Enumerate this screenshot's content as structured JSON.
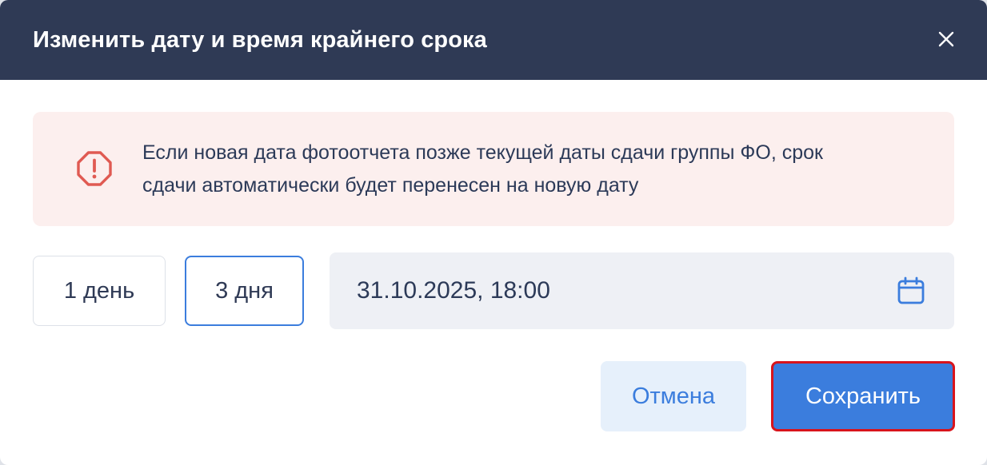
{
  "dialog": {
    "title": "Изменить дату и время крайнего срока",
    "close_icon": "close-icon"
  },
  "alert": {
    "icon": "warning-octagon-icon",
    "line1": "Если новая дата фотоотчета позже текущей даты сдачи группы ФО, срок",
    "line2": "сдачи автоматически будет перенесен на новую дату"
  },
  "quick_options": [
    {
      "label": "1 день",
      "selected": false
    },
    {
      "label": "3 дня",
      "selected": true
    }
  ],
  "datetime": {
    "value": "31.10.2025, 18:00",
    "icon": "calendar-icon"
  },
  "actions": {
    "cancel_label": "Отмена",
    "save_label": "Сохранить"
  },
  "colors": {
    "header_bg": "#2f3a55",
    "accent": "#3b7ddd",
    "alert_bg": "#fcefee",
    "alert_icon": "#e05a52",
    "save_outline": "#d8141c"
  }
}
